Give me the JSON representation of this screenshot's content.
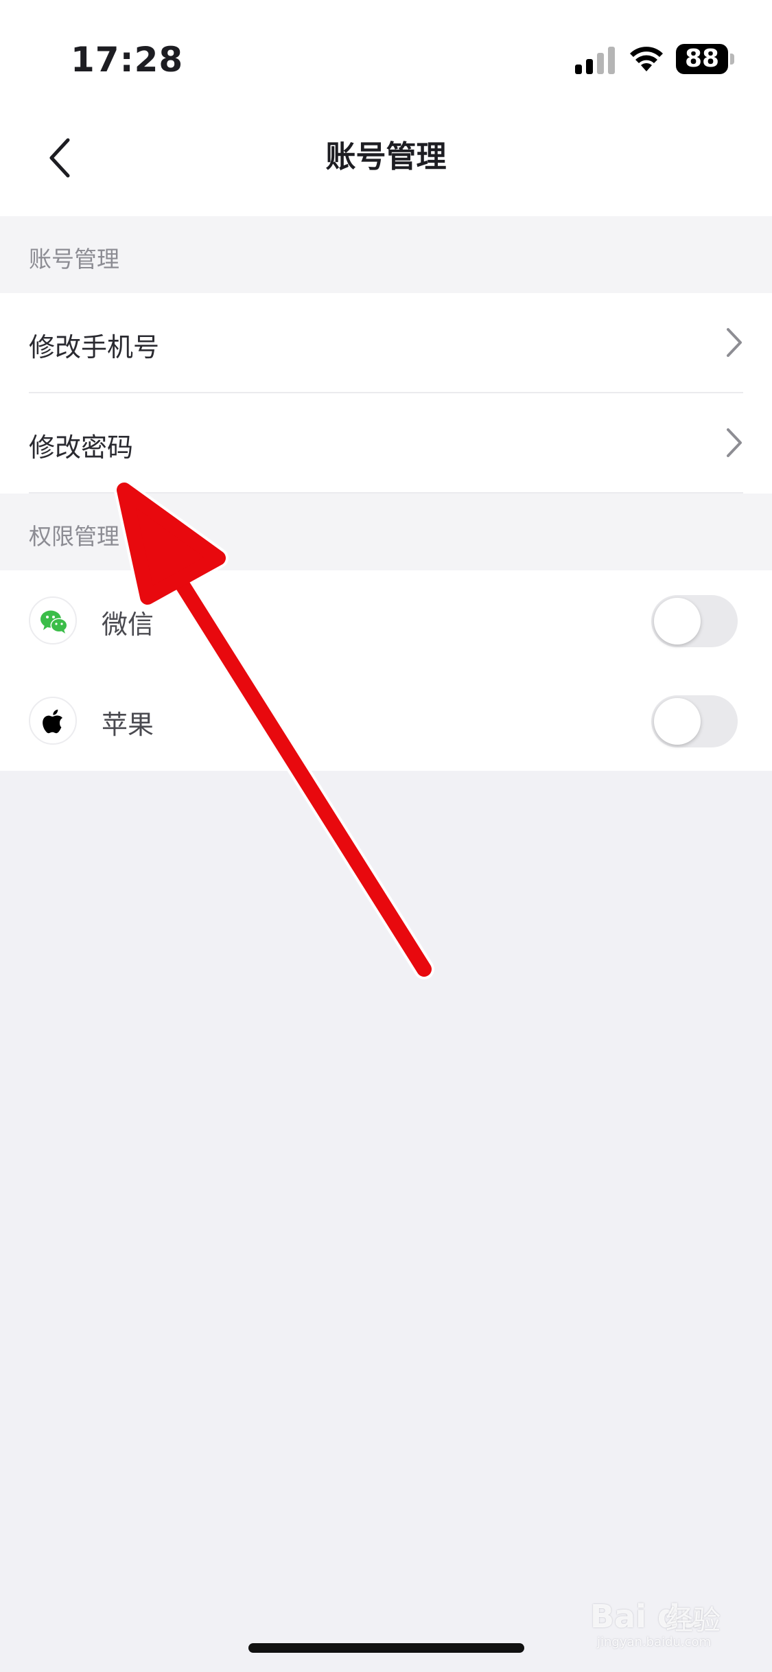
{
  "status_bar": {
    "time": "17:28",
    "battery_level": "88",
    "signal_icon": "cellular-signal-icon",
    "wifi_icon": "wifi-icon"
  },
  "nav": {
    "title": "账号管理",
    "back_icon": "chevron-left-icon"
  },
  "sections": {
    "account": {
      "header": "账号管理",
      "items": [
        {
          "label": "修改手机号",
          "icon": "chevron-right-icon"
        },
        {
          "label": "修改密码",
          "icon": "chevron-right-icon"
        }
      ]
    },
    "permissions": {
      "header": "权限管理",
      "items": [
        {
          "label": "微信",
          "icon": "wechat-icon",
          "enabled": false
        },
        {
          "label": "苹果",
          "icon": "apple-icon",
          "enabled": false
        }
      ]
    }
  },
  "annotation": {
    "color": "#e8090e"
  },
  "watermark": {
    "logo": "Bai du",
    "text": "经验",
    "url": "jingyan.baidu.com"
  },
  "colors": {
    "background": "#f1f1f5",
    "card": "#ffffff",
    "wechat_green": "#3bbd49"
  }
}
